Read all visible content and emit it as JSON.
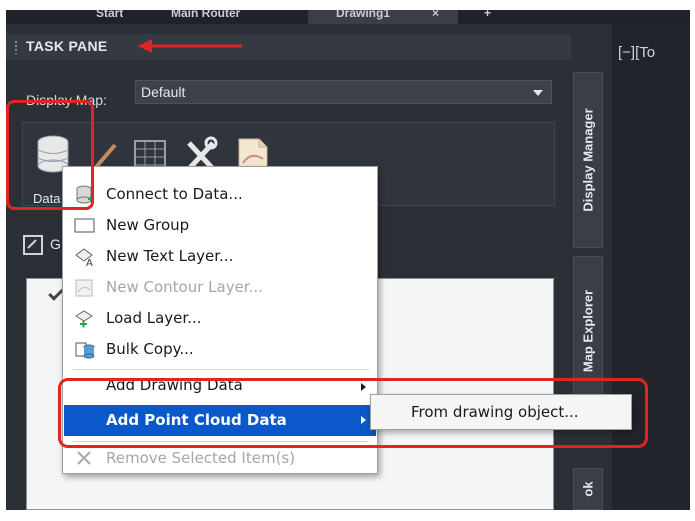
{
  "top_tabs": [
    "Start",
    "Main Router",
    "Drawing1",
    "×",
    "+"
  ],
  "task_pane": {
    "title": "TASK PANE"
  },
  "viewport": {
    "label": "[−][To"
  },
  "side_tabs": [
    "Display Manager",
    "Map Explorer",
    "ok"
  ],
  "display_map": {
    "label": "Display Map:",
    "value": "Default"
  },
  "toolbar": {
    "data_label": "Data"
  },
  "subbar_label": "G",
  "context_menu": {
    "items": [
      {
        "label": "Connect to Data...",
        "icon": "connect-data-icon",
        "enabled": true
      },
      {
        "label": "New Group",
        "icon": "group-icon",
        "enabled": true
      },
      {
        "label": "New Text Layer...",
        "icon": "text-layer-icon",
        "enabled": true
      },
      {
        "label": "New Contour Layer...",
        "icon": "contour-layer-icon",
        "enabled": false
      },
      {
        "label": "Load Layer...",
        "icon": "load-layer-icon",
        "enabled": true
      },
      {
        "label": "Bulk Copy...",
        "icon": "bulk-copy-icon",
        "enabled": true
      },
      {
        "label": "Add Drawing Data",
        "icon": "",
        "enabled": true
      },
      {
        "label": "Add Point Cloud Data",
        "icon": "",
        "enabled": true,
        "highlighted": true
      },
      {
        "label": "Remove Selected Item(s)",
        "icon": "remove-icon",
        "enabled": false
      }
    ]
  },
  "submenu": {
    "items": [
      {
        "label": "From drawing object..."
      }
    ]
  },
  "colors": {
    "highlight": "#0a58ca",
    "annotation": "#e02525"
  }
}
